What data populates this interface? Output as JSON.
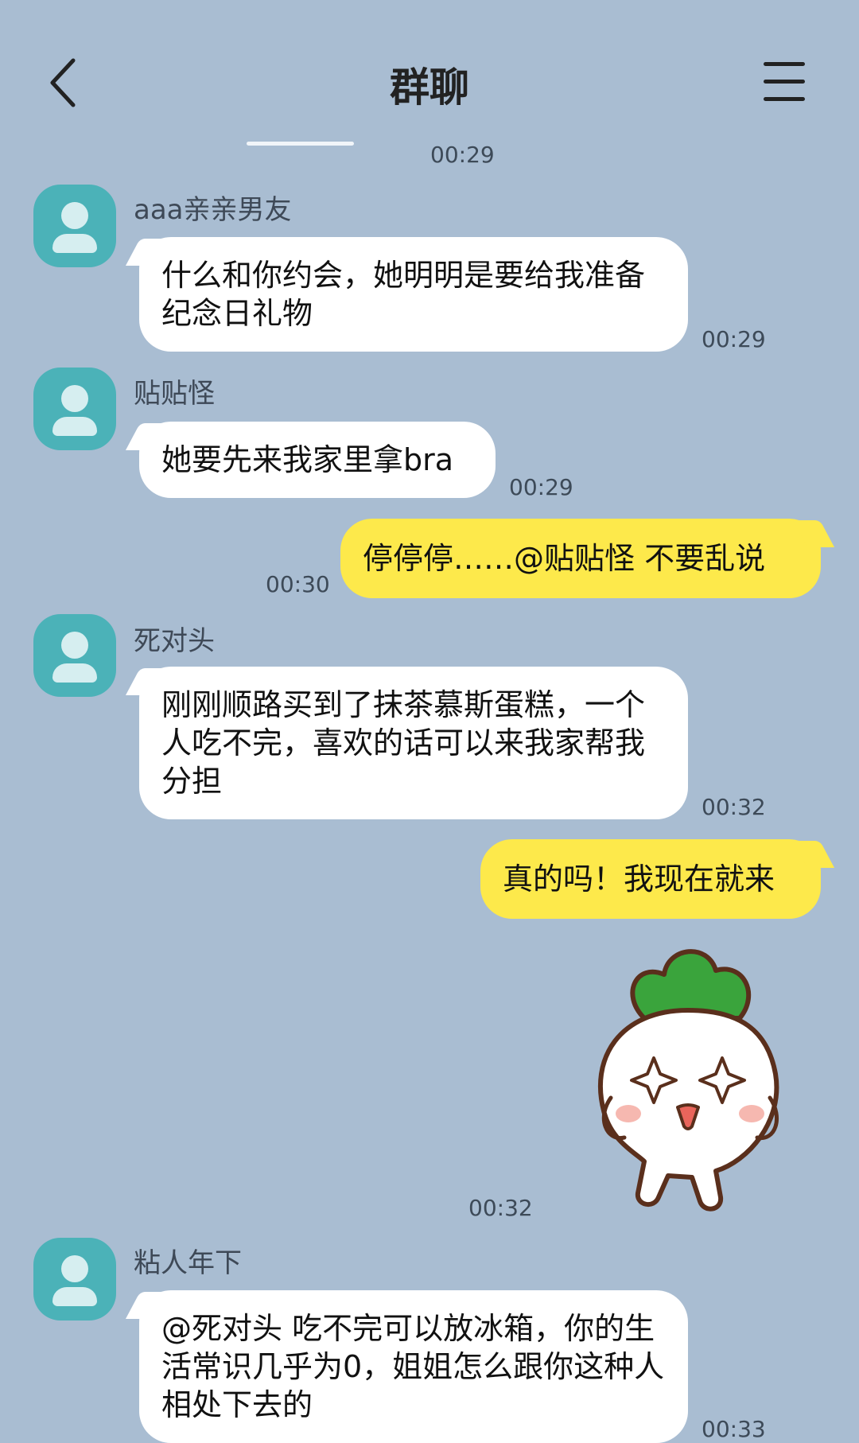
{
  "header": {
    "title": "群聊"
  },
  "messages": [
    {
      "sender": "",
      "time": "00:29",
      "text": ""
    },
    {
      "sender": "aaa亲亲男友",
      "time": "00:29",
      "text": "什么和你约会，她明明是要给我准备纪念日礼物"
    },
    {
      "sender": "贴贴怪",
      "time": "00:29",
      "text": "她要先来我家里拿bra"
    },
    {
      "sender": "me",
      "time": "00:30",
      "text": "停停停……@贴贴怪 不要乱说"
    },
    {
      "sender": "死对头",
      "time": "00:32",
      "text": "刚刚顺路买到了抹茶慕斯蛋糕，一个人吃不完，喜欢的话可以来我家帮我分担"
    },
    {
      "sender": "me",
      "time": "",
      "text": "真的吗！我现在就来"
    },
    {
      "sender": "me",
      "time": "00:32",
      "text": "",
      "sticker": "radish-sticker"
    },
    {
      "sender": "粘人年下",
      "time": "00:33",
      "text": "@死对头 吃不完可以放冰箱，你的生活常识几乎为0，姐姐怎么跟你这种人相处下去的"
    }
  ],
  "colors": {
    "background": "#a9bdd2",
    "incoming_bubble": "#ffffff",
    "outgoing_bubble": "#fde94b",
    "avatar": "#4bb2b8"
  }
}
